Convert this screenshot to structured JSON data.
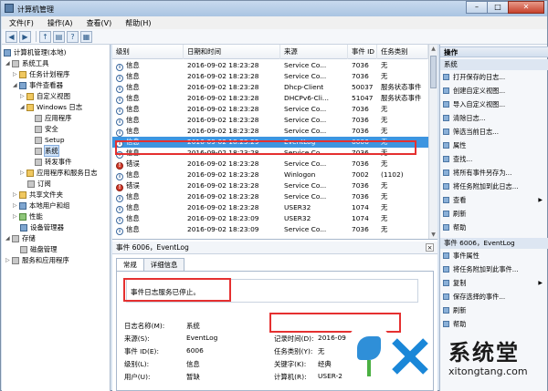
{
  "window": {
    "title": "计算机管理",
    "min": "–",
    "max": "□",
    "close": "✕"
  },
  "menu": [
    "文件(F)",
    "操作(A)",
    "查看(V)",
    "帮助(H)"
  ],
  "toolbar": {
    "back": "◀",
    "forward": "▶",
    "up": "↑",
    "props": "▤",
    "help": "?",
    "pane": "▦"
  },
  "tree": {
    "root": "计算机管理(本地)",
    "system_tools": "系统工具",
    "task_scheduler": "任务计划程序",
    "event_viewer": "事件查看器",
    "custom_views": "自定义视图",
    "windows_logs": "Windows 日志",
    "application": "应用程序",
    "security": "安全",
    "setup": "Setup",
    "system": "系统",
    "forwarded": "转发事件",
    "app_service_logs": "应用程序和服务日志",
    "subscriptions": "订阅",
    "shared_folders": "共享文件夹",
    "local_users": "本地用户和组",
    "performance": "性能",
    "device_manager": "设备管理器",
    "storage": "存储",
    "disk_mgmt": "磁盘管理",
    "services_apps": "服务和应用程序"
  },
  "list": {
    "headers": [
      "级别",
      "日期和时间",
      "来源",
      "事件 ID",
      "任务类别"
    ],
    "rows": [
      [
        "信息",
        "2016-09-02 18:23:28",
        "Service Co...",
        "7036",
        "无"
      ],
      [
        "信息",
        "2016-09-02 18:23:28",
        "Service Co...",
        "7036",
        "无"
      ],
      [
        "信息",
        "2016-09-02 18:23:28",
        "Dhcp-Client",
        "50037",
        "服务状态事件"
      ],
      [
        "信息",
        "2016-09-02 18:23:28",
        "DHCPv6-Cli...",
        "51047",
        "服务状态事件"
      ],
      [
        "信息",
        "2016-09-02 18:23:28",
        "Service Co...",
        "7036",
        "无"
      ],
      [
        "信息",
        "2016-09-02 18:23:28",
        "Service Co...",
        "7036",
        "无"
      ],
      [
        "信息",
        "2016-09-02 18:23:28",
        "Service Co...",
        "7036",
        "无"
      ],
      [
        "信息",
        "2016-09-02 18:23:29",
        "EventLog",
        "6006",
        "无"
      ],
      [
        "信息",
        "2016-09-02 18:23:28",
        "Service Co...",
        "7036",
        "无"
      ],
      [
        "错误",
        "2016-09-02 18:23:28",
        "Service Co...",
        "7036",
        "无"
      ],
      [
        "信息",
        "2016-09-02 18:23:28",
        "Winlogon",
        "7002",
        "(1102)"
      ],
      [
        "错误",
        "2016-09-02 18:23:28",
        "Service Co...",
        "7036",
        "无"
      ],
      [
        "信息",
        "2016-09-02 18:23:28",
        "Service Co...",
        "7036",
        "无"
      ],
      [
        "信息",
        "2016-09-02 18:23:28",
        "USER32",
        "1074",
        "无"
      ],
      [
        "信息",
        "2016-09-02 18:23:09",
        "USER32",
        "1074",
        "无"
      ],
      [
        "信息",
        "2016-09-02 18:23:09",
        "Service Co...",
        "7036",
        "无"
      ]
    ]
  },
  "detail": {
    "title": "事件 6006，EventLog",
    "close": "×",
    "tab_general": "常规",
    "tab_details": "详细信息",
    "message": "事件日志服务已停止。",
    "log_name_label": "日志名称(M):",
    "log_name": "系统",
    "source_label": "来源(S):",
    "source": "EventLog",
    "recorded_label": "记录时间(D):",
    "recorded": "2016-09",
    "event_id_label": "事件 ID(E):",
    "event_id": "6006",
    "task_label": "任务类别(Y):",
    "task": "无",
    "level_label": "级别(L):",
    "level": "信息",
    "keywords_label": "关键字(K):",
    "keywords": "经典",
    "user_label": "用户(U):",
    "user": "暂缺",
    "computer_label": "计算机(R):",
    "computer": "USER-2"
  },
  "actions": {
    "header": "操作",
    "section1": "系统",
    "items1": [
      "打开保存的日志...",
      "创建自定义视图...",
      "导入自定义视图...",
      "清除日志...",
      "筛选当前日志...",
      "属性",
      "查找...",
      "将所有事件另存为...",
      "将任务附加到此日志...",
      "查看",
      "刷新",
      "帮助"
    ],
    "section2": "事件 6006，EventLog",
    "items2": [
      "事件属性",
      "将任务附加到此事件...",
      "复制",
      "保存选择的事件...",
      "刷新",
      "帮助"
    ]
  },
  "watermark": {
    "text": "系统堂",
    "url": "xitongtang.com"
  },
  "colors": {
    "highlight": "#e53030",
    "selected_row": "#3d95e0"
  }
}
